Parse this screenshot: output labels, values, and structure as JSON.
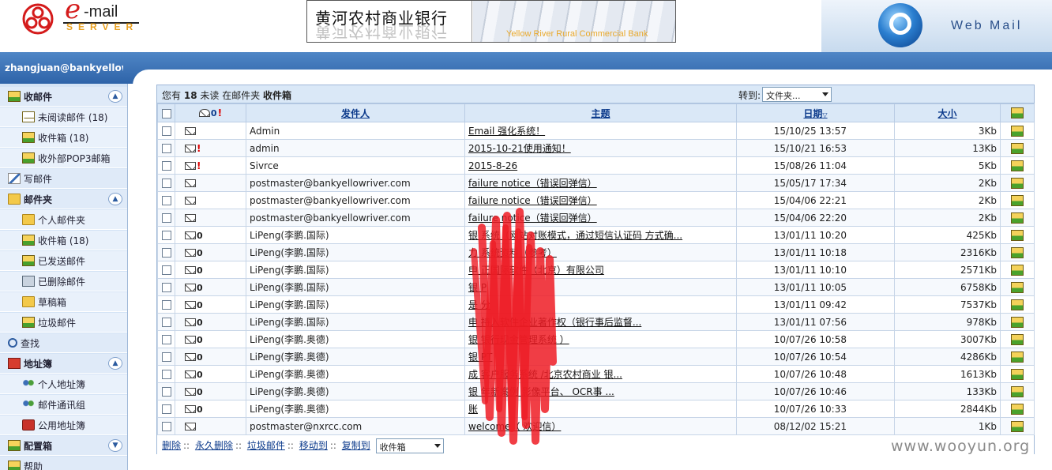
{
  "header": {
    "logo_e": "e",
    "logo_mail": "-mail",
    "logo_server": "SERVER",
    "bank_name_cn": "黄河农村商业银行",
    "bank_name_en": "Yellow River Rural Commercial Bank",
    "product_label": "Web Mail"
  },
  "user": {
    "email": "zhangjuan@bankyellowri..."
  },
  "sidebar": {
    "items": [
      {
        "label": "收邮件",
        "icon": "tray-icon"
      },
      {
        "label": "未阅读邮件 (18)",
        "icon": "envelope-icon"
      },
      {
        "label": "收件箱 (18)",
        "icon": "inbox-icon"
      },
      {
        "label": "收外部POP3邮箱",
        "icon": "pop3-icon"
      },
      {
        "label": "写邮件",
        "icon": "compose-icon"
      },
      {
        "label": "邮件夹",
        "icon": "folders-icon"
      },
      {
        "label": "个人邮件夹",
        "icon": "folder-icon"
      },
      {
        "label": "收件箱 (18)",
        "icon": "inbox-icon"
      },
      {
        "label": "已发送邮件",
        "icon": "sent-icon"
      },
      {
        "label": "已删除邮件",
        "icon": "deleted-icon"
      },
      {
        "label": "草稿箱",
        "icon": "drafts-icon"
      },
      {
        "label": "垃圾邮件",
        "icon": "trash-icon"
      },
      {
        "label": "查找",
        "icon": "search-icon"
      },
      {
        "label": "地址簿",
        "icon": "addressbook-icon"
      },
      {
        "label": "个人地址簿",
        "icon": "people-icon"
      },
      {
        "label": "邮件通讯组",
        "icon": "group-icon"
      },
      {
        "label": "公用地址簿",
        "icon": "public-book-icon"
      },
      {
        "label": "配置箱",
        "icon": "config-icon"
      },
      {
        "label": "帮助",
        "icon": "help-icon"
      }
    ]
  },
  "panel": {
    "unread_prefix": "您有",
    "unread_count": "18",
    "unread_middle": "未读 在邮件夹",
    "folder_name": "收件箱",
    "goto_label": "转到:",
    "goto_select": "文件夹..."
  },
  "table": {
    "headers": {
      "sender": "发件人",
      "subject": "主题",
      "date": "日期",
      "size": "大小"
    },
    "rows": [
      {
        "prio": false,
        "attach": false,
        "sender": "Admin",
        "subject": "Email 强化系统！",
        "date": "15/10/25 13:57",
        "size": "3Kb"
      },
      {
        "prio": true,
        "attach": false,
        "sender": "admin",
        "subject": "2015-10-21使用通知！",
        "date": "15/10/21 16:53",
        "size": "13Kb"
      },
      {
        "prio": true,
        "attach": false,
        "sender": "Sivrce",
        "subject": "2015-8-26",
        "date": "15/08/26 11:04",
        "size": "5Kb"
      },
      {
        "prio": false,
        "attach": false,
        "sender": "postmaster@bankyellowriver.com",
        "subject": "failure notice（错误回弹信）",
        "date": "15/05/17 17:34",
        "size": "2Kb"
      },
      {
        "prio": false,
        "attach": false,
        "sender": "postmaster@bankyellowriver.com",
        "subject": "failure notice（错误回弹信）",
        "date": "15/04/06 22:21",
        "size": "2Kb"
      },
      {
        "prio": false,
        "attach": false,
        "sender": "postmaster@bankyellowriver.com",
        "subject": "failure notice（错误回弹信）",
        "date": "15/04/06 22:20",
        "size": "2Kb"
      },
      {
        "prio": false,
        "attach": true,
        "sender": "LiPeng(李鹏.国际)",
        "subject": "银 系统（网站对账模式，通过短信认证码 方式确...",
        "date": "13/01/11 10:20",
        "size": "425Kb"
      },
      {
        "prio": false,
        "attach": true,
        "sender": "LiPeng(李鹏.国际)",
        "subject": "力 系统资料（参考）",
        "date": "13/01/11 10:18",
        "size": "2316Kb"
      },
      {
        "prio": false,
        "attach": true,
        "sender": "LiPeng(李鹏.国际)",
        "subject": "申 正国际软件（北京）有限公司",
        "date": "13/01/11 10:10",
        "size": "2571Kb"
      },
      {
        "prio": false,
        "attach": true,
        "sender": "LiPeng(李鹏.国际)",
        "subject": "银 P",
        "date": "13/01/11 10:05",
        "size": "6758Kb"
      },
      {
        "prio": false,
        "attach": true,
        "sender": "LiPeng(李鹏.国际)",
        "subject": "是 分",
        "date": "13/01/11 09:42",
        "size": "7537Kb"
      },
      {
        "prio": false,
        "attach": true,
        "sender": "LiPeng(李鹏.国际)",
        "subject": "申 持入软件企业著作权（银行事后监督...",
        "date": "13/01/11 07:56",
        "size": "978Kb"
      },
      {
        "prio": false,
        "attach": true,
        "sender": "LiPeng(李鹏.奥德)",
        "subject": "银 银行现金管理系统 ）",
        "date": "10/07/26 10:58",
        "size": "3007Kb"
      },
      {
        "prio": false,
        "attach": true,
        "sender": "LiPeng(李鹏.奥德)",
        "subject": "银 PT",
        "date": "10/07/26 10:54",
        "size": "4286Kb"
      },
      {
        "prio": false,
        "attach": true,
        "sender": "LiPeng(李鹏.奥德)",
        "subject": "成 客户服务系统 /北京农村商业 银...",
        "date": "10/07/26 10:48",
        "size": "1613Kb"
      },
      {
        "prio": false,
        "attach": true,
        "sender": "LiPeng(李鹏.奥德)",
        "subject": "银 年新案例 影像平台、 OCR事 ...",
        "date": "10/07/26 10:46",
        "size": "133Kb"
      },
      {
        "prio": false,
        "attach": true,
        "sender": "LiPeng(李鹏.奥德)",
        "subject": "账",
        "date": "10/07/26 10:33",
        "size": "2844Kb"
      },
      {
        "prio": false,
        "attach": false,
        "sender": "postmaster@nxrcc.com",
        "subject": "welcome（ 欢迎信）",
        "date": "08/12/02 15:21",
        "size": "1Kb"
      }
    ]
  },
  "footer": {
    "delete": "删除",
    "perm_delete": "永久删除",
    "junk": "垃圾邮件",
    "move_to": "移动到",
    "copy_to": "复制到",
    "copy_select": "收件箱",
    "separator": "::"
  },
  "watermark": "www.wooyun.org",
  "colors": {
    "header_blue": "#2e63a8",
    "sidebar_bg": "#d4e3f5",
    "table_header": "#dae8f7",
    "link": "#0d3b8c",
    "priority_red": "#d00000",
    "redaction_red": "#ee1c24"
  }
}
